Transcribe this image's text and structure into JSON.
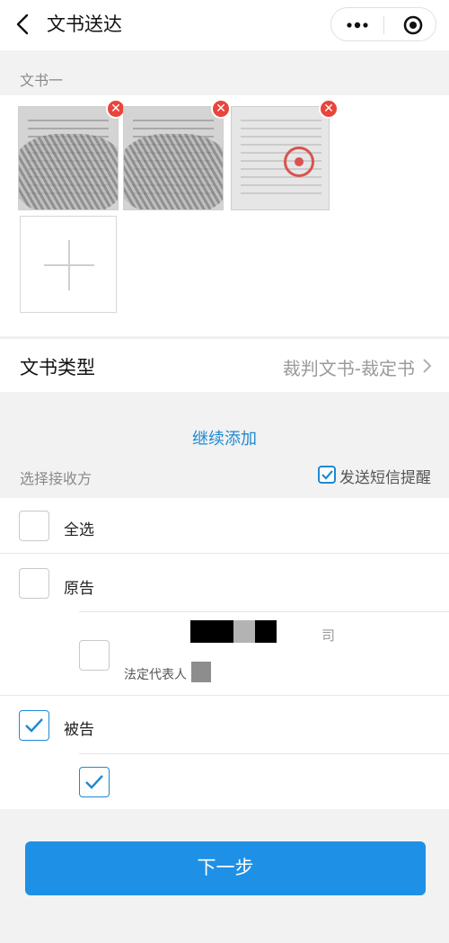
{
  "nav": {
    "title": "文书送达",
    "more_icon": "more-dots-icon",
    "target_icon": "target-icon"
  },
  "doc_section": {
    "label": "文书一",
    "thumbnails": [
      "document-image-1",
      "document-image-2",
      "document-image-3"
    ],
    "delete_glyph": "✕"
  },
  "doc_type": {
    "label": "文书类型",
    "value": "裁判文书-裁定书"
  },
  "continue_label": "继续添加",
  "receivers": {
    "label": "选择接收方",
    "sms_label": "发送短信提醒",
    "sms_checked": true,
    "select_all": "全选",
    "plaintiff": "原告",
    "plaintiff_entry": {
      "suffix_char": "司",
      "sub_label": "法定代表人"
    },
    "defendant": "被告",
    "defendant_checked": true,
    "defendant_sub_checked": true
  },
  "next_label": "下一步",
  "colors": {
    "accent": "#1e90e6",
    "link": "#1f89d1",
    "delete_badge": "#e8453c"
  }
}
